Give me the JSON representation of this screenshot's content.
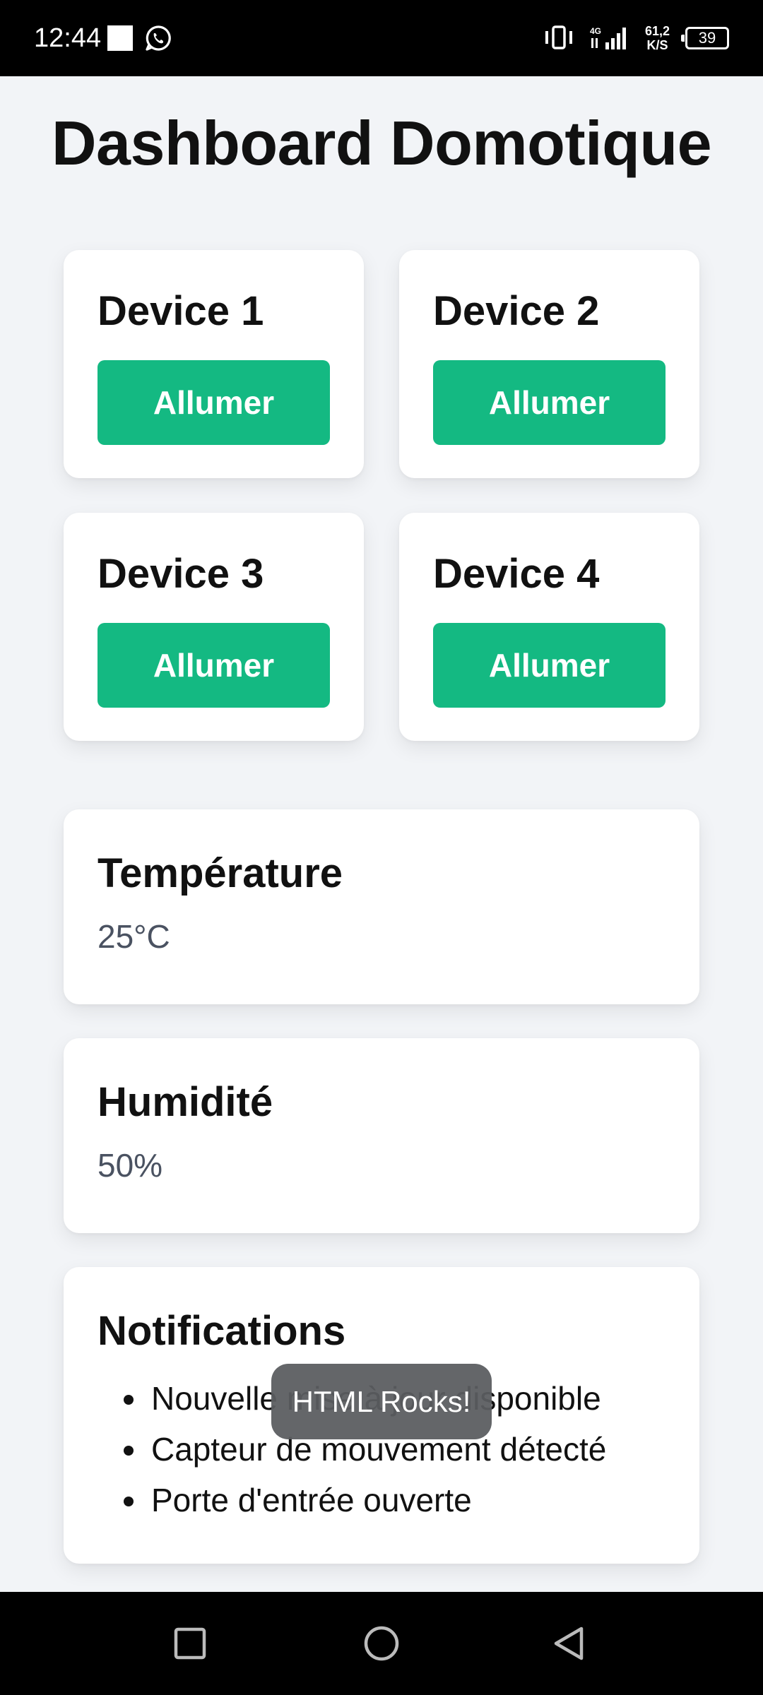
{
  "status_bar": {
    "time": "12:44",
    "network": "4G",
    "speed_value": "61,2",
    "speed_unit": "K/S",
    "battery": "39"
  },
  "page": {
    "title": "Dashboard Domotique"
  },
  "devices": [
    {
      "name": "Device 1",
      "button_label": "Allumer"
    },
    {
      "name": "Device 2",
      "button_label": "Allumer"
    },
    {
      "name": "Device 3",
      "button_label": "Allumer"
    },
    {
      "name": "Device 4",
      "button_label": "Allumer"
    }
  ],
  "temperature": {
    "title": "Température",
    "value": "25°C"
  },
  "humidity": {
    "title": "Humidité",
    "value": "50%"
  },
  "notifications": {
    "title": "Notifications",
    "items": [
      "Nouvelle mise à jour disponible",
      "Capteur de mouvement détecté",
      "Porte d'entrée ouverte"
    ]
  },
  "toast": {
    "message": "HTML Rocks!"
  },
  "colors": {
    "accent": "#14b982",
    "background": "#f2f4f7",
    "card": "#ffffff",
    "muted_text": "#4a5261"
  },
  "icons": {
    "status_left": [
      "notification-square-icon",
      "whatsapp-icon"
    ],
    "status_right": [
      "vibrate-icon",
      "signal-icon",
      "battery-icon"
    ],
    "nav": [
      "recents-square-icon",
      "home-circle-icon",
      "back-triangle-icon"
    ]
  }
}
